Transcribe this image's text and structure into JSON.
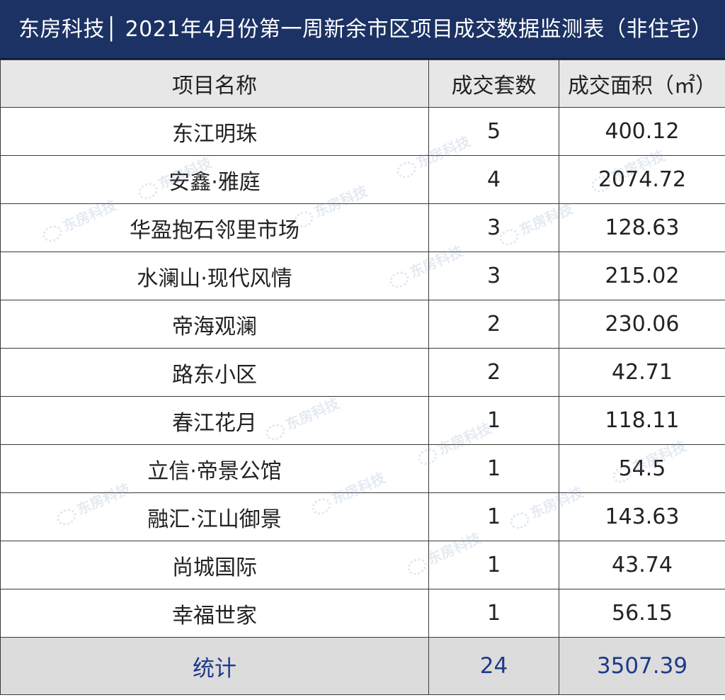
{
  "title": "东房科技│ 2021年4月份第一周新余市区项目成交数据监测表（非住宅）",
  "columns": [
    "项目名称",
    "成交套数",
    "成交面积（㎡）"
  ],
  "rows": [
    {
      "name": "东江明珠",
      "units": "5",
      "area": "400.12"
    },
    {
      "name": "安鑫·雅庭",
      "units": "4",
      "area": "2074.72"
    },
    {
      "name": "华盈抱石邻里市场",
      "units": "3",
      "area": "128.63"
    },
    {
      "name": "水澜山·现代风情",
      "units": "3",
      "area": "215.02"
    },
    {
      "name": "帝海观澜",
      "units": "2",
      "area": "230.06"
    },
    {
      "name": "路东小区",
      "units": "2",
      "area": "42.71"
    },
    {
      "name": "春江花月",
      "units": "1",
      "area": "118.11"
    },
    {
      "name": "立信·帝景公馆",
      "units": "1",
      "area": "54.5"
    },
    {
      "name": "融汇·江山御景",
      "units": "1",
      "area": "143.63"
    },
    {
      "name": "尚城国际",
      "units": "1",
      "area": "43.74"
    },
    {
      "name": "幸福世家",
      "units": "1",
      "area": "56.15"
    }
  ],
  "total": {
    "label": "统计",
    "units": "24",
    "area": "3507.39"
  },
  "watermark_text": "东房科技",
  "colors": {
    "title_bg": "#1c3264",
    "header_bg": "#e7e7e7",
    "total_bg": "#dcdcdc",
    "total_text": "#1e3a8a"
  }
}
